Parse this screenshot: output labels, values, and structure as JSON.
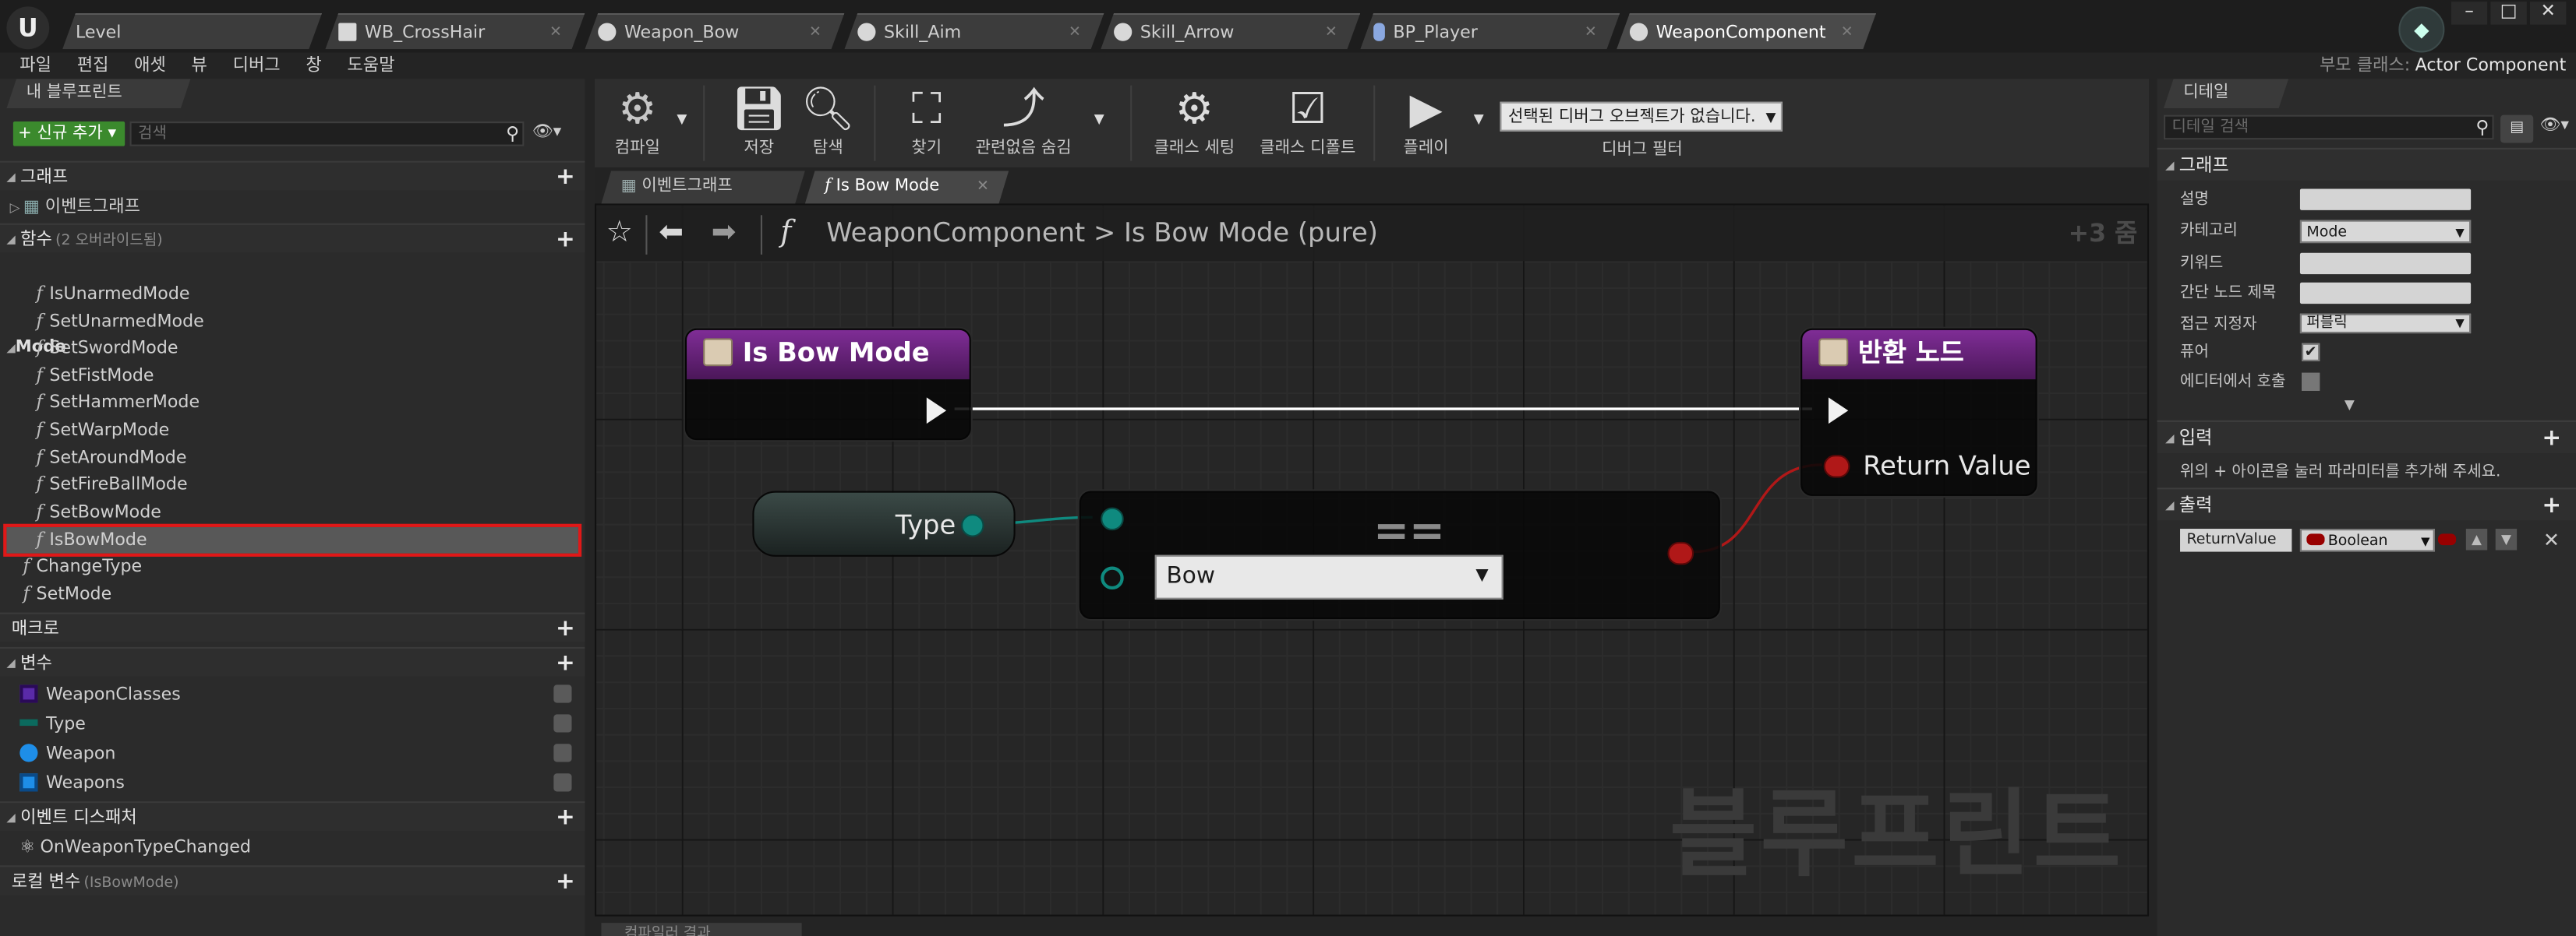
{
  "tabs": [
    {
      "label": "Level"
    },
    {
      "label": "WB_CrossHair"
    },
    {
      "label": "Weapon_Bow"
    },
    {
      "label": "Skill_Aim"
    },
    {
      "label": "Skill_Arrow"
    },
    {
      "label": "BP_Player"
    },
    {
      "label": "WeaponComponent"
    }
  ],
  "app_logo": "U",
  "menu": [
    "파일",
    "편집",
    "애셋",
    "뷰",
    "디버그",
    "창",
    "도움말"
  ],
  "parent_class": {
    "label": "부모 클래스:",
    "value": "Actor Component"
  },
  "my_blueprint": {
    "tab_label": "내 블루프린트",
    "add_new_label": "+ 신규 추가 ▾",
    "search_placeholder": "검색",
    "sections": {
      "graph": "그래프",
      "event_graph": "이벤트그래프",
      "functions": "함수",
      "functions_sub": "(2 오버라이드됨)",
      "mode_category": "Mode",
      "macros": "매크로",
      "variables": "변수",
      "event_dispatchers": "이벤트 디스패처",
      "local_vars": "로컬 변수",
      "local_vars_sub": "(IsBowMode)"
    },
    "functions": [
      "IsUnarmedMode",
      "SetUnarmedMode",
      "SetSwordMode",
      "SetFistMode",
      "SetHammerMode",
      "SetWarpMode",
      "SetAroundMode",
      "SetFireBallMode",
      "SetBowMode",
      "IsBowMode"
    ],
    "other_functions": [
      "ChangeType",
      "SetMode"
    ],
    "variables": [
      {
        "name": "WeaponClasses",
        "color": "#5a2aa8"
      },
      {
        "name": "Type",
        "color": "#0b6a5e"
      },
      {
        "name": "Weapon",
        "color": "#1e8ee8"
      },
      {
        "name": "Weapons",
        "color": "#1e8ee8"
      }
    ],
    "dispatchers": [
      "OnWeaponTypeChanged"
    ]
  },
  "toolbar": {
    "compile": "컴파일",
    "save": "저장",
    "browse": "탐색",
    "find": "찾기",
    "hide_unrelated": "관련없음 숨김",
    "class_settings": "클래스 세팅",
    "class_defaults": "클래스 디폴트",
    "play": "플레이",
    "debug_object": "선택된 디버그 오브젝트가 없습니다.",
    "debug_filter": "디버그 필터"
  },
  "graph_tabs": [
    "이벤트그래프",
    "Is Bow Mode"
  ],
  "graph": {
    "breadcrumb_root": "WeaponComponent",
    "breadcrumb_sep": ">",
    "breadcrumb_leaf": "Is Bow Mode (pure)",
    "zoom": "+3 줌",
    "watermark": "블루프린트",
    "entry_node_title": "Is Bow Mode",
    "return_node_title": "반환 노드",
    "return_value_label": "Return Value",
    "var_node_label": "Type",
    "equal_node_symbol": "==",
    "enum_value": "Bow"
  },
  "bottom_tab": "컴파일러 결과",
  "details": {
    "tab_label": "디테일",
    "search_placeholder": "디테일 검색",
    "graph_section": "그래프",
    "props": {
      "description": "설명",
      "category": "카테고리",
      "category_value": "Mode",
      "keywords": "키워드",
      "compact_title": "간단 노드 제목",
      "access": "접근 지정자",
      "access_value": "퍼블릭",
      "pure": "퓨어",
      "call_in_editor": "에디터에서 호출"
    },
    "pure_checked": true,
    "call_in_editor_checked": false,
    "inputs_section": "입력",
    "inputs_hint": "위의 + 아이콘을 눌러 파라미터를 추가해 주세요.",
    "outputs_section": "출력",
    "output_name": "ReturnValue",
    "output_type": "Boolean"
  }
}
